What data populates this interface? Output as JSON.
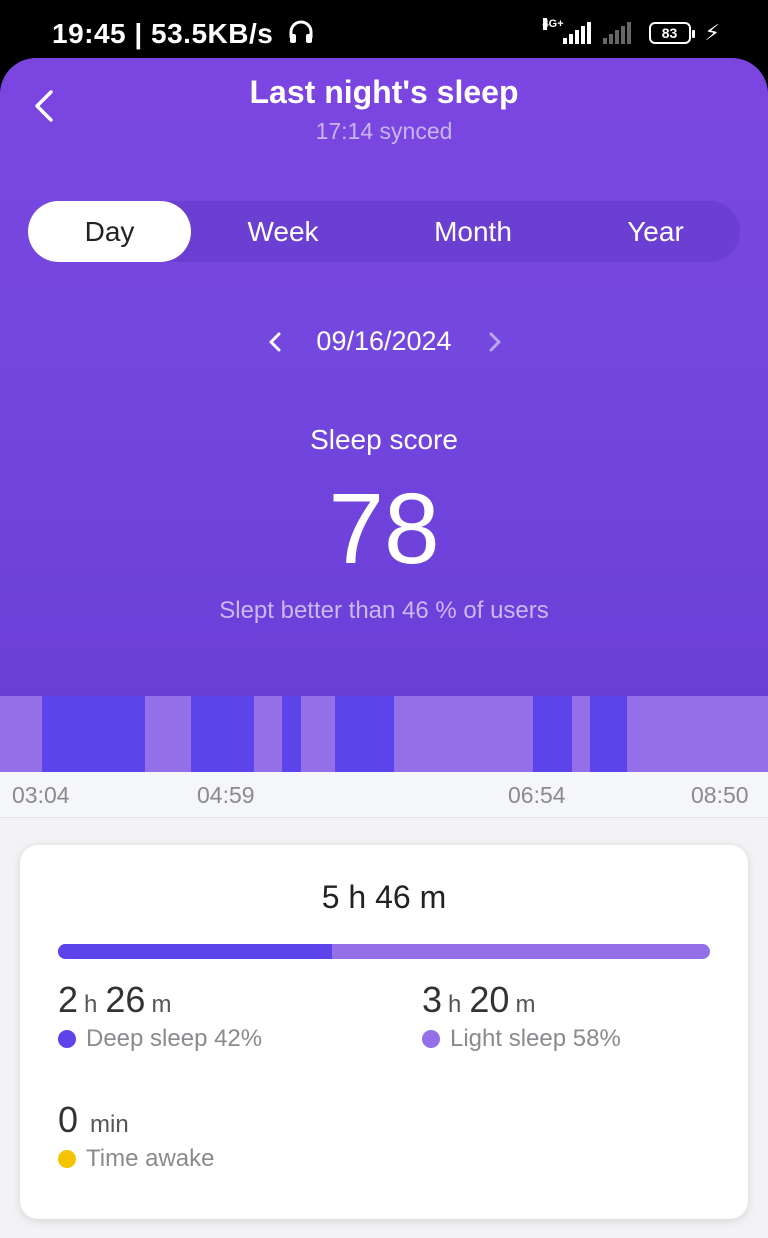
{
  "status_bar": {
    "time": "19:45",
    "speed": "53.5KB/s",
    "network_label": "4G+",
    "battery": "83",
    "icons": [
      "headphone-icon",
      "signal-icon",
      "battery-icon",
      "charging-bolt-icon"
    ]
  },
  "header": {
    "title": "Last night's sleep",
    "subtitle": "17:14 synced",
    "back_icon": "chevron-left-icon"
  },
  "tabs": [
    {
      "label": "Day",
      "active": true
    },
    {
      "label": "Week",
      "active": false
    },
    {
      "label": "Month",
      "active": false
    },
    {
      "label": "Year",
      "active": false
    }
  ],
  "date_nav": {
    "date": "09/16/2024",
    "prev_icon": "chevron-left-icon",
    "next_icon": "chevron-right-icon"
  },
  "score": {
    "label": "Sleep score",
    "value": "78",
    "note": "Slept better than 46 % of users"
  },
  "hypnogram": {
    "start": "03:04",
    "end": "08:50",
    "tick_labels": [
      "03:04",
      "04:59",
      "06:54",
      "08:50"
    ],
    "colors": {
      "deep": "#5c43ea",
      "light": "#9370e8"
    },
    "segments": [
      {
        "stage": "light",
        "from": "03:04",
        "to": "03:23"
      },
      {
        "stage": "deep",
        "from": "03:23",
        "to": "04:10"
      },
      {
        "stage": "light",
        "from": "04:10",
        "to": "04:30"
      },
      {
        "stage": "deep",
        "from": "04:30",
        "to": "04:59"
      },
      {
        "stage": "light",
        "from": "04:59",
        "to": "05:11"
      },
      {
        "stage": "deep",
        "from": "05:11",
        "to": "05:20"
      },
      {
        "stage": "light",
        "from": "05:20",
        "to": "05:35"
      },
      {
        "stage": "deep",
        "from": "05:35",
        "to": "06:02"
      },
      {
        "stage": "light",
        "from": "06:02",
        "to": "07:04"
      },
      {
        "stage": "deep",
        "from": "07:04",
        "to": "07:22"
      },
      {
        "stage": "light",
        "from": "07:22",
        "to": "07:30"
      },
      {
        "stage": "deep",
        "from": "07:30",
        "to": "07:47"
      },
      {
        "stage": "light",
        "from": "07:47",
        "to": "08:50"
      }
    ]
  },
  "summary": {
    "total": "5 h 46 m",
    "deep_fraction": 0.42,
    "deep": {
      "hours": "2",
      "h_unit": "h",
      "minutes": "26",
      "m_unit": "m",
      "label": "Deep sleep 42%",
      "color": "#5c43ea"
    },
    "light": {
      "hours": "3",
      "h_unit": "h",
      "minutes": "20",
      "m_unit": "m",
      "label": "Light sleep 58%",
      "color": "#9370e8"
    },
    "awake": {
      "value": "0",
      "unit": "min",
      "label": "Time awake",
      "color": "#f5c400"
    }
  }
}
